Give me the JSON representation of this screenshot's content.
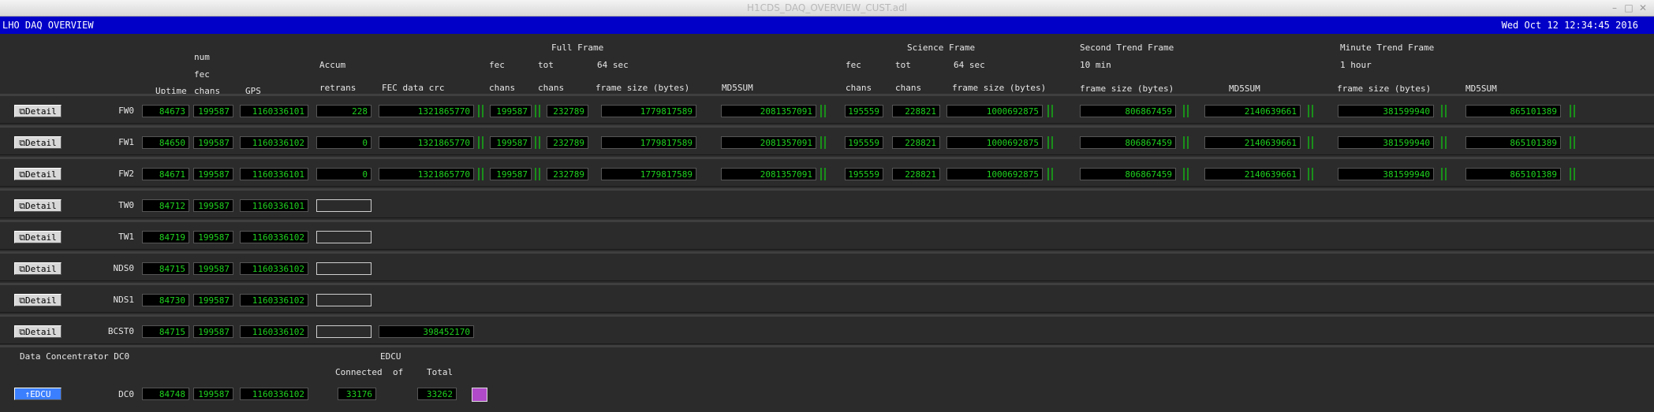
{
  "window": {
    "title": "H1CDS_DAQ_OVERVIEW_CUST.adl"
  },
  "header": {
    "left": "LHO DAQ OVERVIEW",
    "right": "Wed Oct 12 12:34:45 2016"
  },
  "groups": {
    "full_frame": "Full Frame",
    "science_frame": "Science Frame",
    "second_trend": "Second Trend Frame",
    "minute_trend": "Minute Trend Frame"
  },
  "col": {
    "num": "num",
    "fec": "fec",
    "chans": "chans",
    "uptime": "Uptime",
    "gps": "GPS",
    "accum": "Accum",
    "retrans": "retrans",
    "fec_crc": "FEC data crc",
    "ff_fec": "fec",
    "ff_chans1": "chans",
    "ff_tot": "tot",
    "ff_chans2": "chans",
    "ff_64": "64 sec",
    "ff_size": "frame size (bytes)",
    "ff_md5": "MD5SUM",
    "sf_fec": "fec",
    "sf_chans1": "chans",
    "sf_tot": "tot",
    "sf_chans2": "chans",
    "sf_64": "64 sec",
    "sf_size": "frame size (bytes)",
    "st_10": "10 min",
    "st_size": "frame size (bytes)",
    "st_md5": "MD5SUM",
    "mt_1h": "1 hour",
    "mt_size": "frame size (bytes)",
    "mt_md5": "MD5SUM"
  },
  "detail_label": "Detail",
  "rows": [
    {
      "name": "FW0",
      "uptime": "84673",
      "chans": "199587",
      "gps": "1160336101",
      "retrans": "228",
      "crc": "1321865770",
      "ff_fec": "199587",
      "ff_tot": "232789",
      "ff_size": "1779817589",
      "ff_md5": "2081357091",
      "sf_fec": "195559",
      "sf_tot": "228821",
      "sf_size": "1000692875",
      "st_size": "806867459",
      "st_md5": "2140639661",
      "mt_size": "381599940",
      "mt_md5": "865101389"
    },
    {
      "name": "FW1",
      "uptime": "84650",
      "chans": "199587",
      "gps": "1160336102",
      "retrans": "0",
      "crc": "1321865770",
      "ff_fec": "199587",
      "ff_tot": "232789",
      "ff_size": "1779817589",
      "ff_md5": "2081357091",
      "sf_fec": "195559",
      "sf_tot": "228821",
      "sf_size": "1000692875",
      "st_size": "806867459",
      "st_md5": "2140639661",
      "mt_size": "381599940",
      "mt_md5": "865101389"
    },
    {
      "name": "FW2",
      "uptime": "84671",
      "chans": "199587",
      "gps": "1160336101",
      "retrans": "0",
      "crc": "1321865770",
      "ff_fec": "199587",
      "ff_tot": "232789",
      "ff_size": "1779817589",
      "ff_md5": "2081357091",
      "sf_fec": "195559",
      "sf_tot": "228821",
      "sf_size": "1000692875",
      "st_size": "806867459",
      "st_md5": "2140639661",
      "mt_size": "381599940",
      "mt_md5": "865101389"
    },
    {
      "name": "TW0",
      "uptime": "84712",
      "chans": "199587",
      "gps": "1160336101"
    },
    {
      "name": "TW1",
      "uptime": "84719",
      "chans": "199587",
      "gps": "1160336102"
    },
    {
      "name": "NDS0",
      "uptime": "84715",
      "chans": "199587",
      "gps": "1160336102"
    },
    {
      "name": "NDS1",
      "uptime": "84730",
      "chans": "199587",
      "gps": "1160336102"
    },
    {
      "name": "BCST0",
      "uptime": "84715",
      "chans": "199587",
      "gps": "1160336102",
      "crc": "398452170"
    }
  ],
  "dc": {
    "title": "Data Concentrator DC0",
    "edcu": "EDCU",
    "connected_lbl": "Connected",
    "of_lbl": "of",
    "total_lbl": "Total",
    "button": "EDCU",
    "name": "DC0",
    "uptime": "84748",
    "chans": "199587",
    "gps": "1160336102",
    "connected": "33176",
    "total": "33262",
    "swatch_color": "#b04ac8"
  }
}
